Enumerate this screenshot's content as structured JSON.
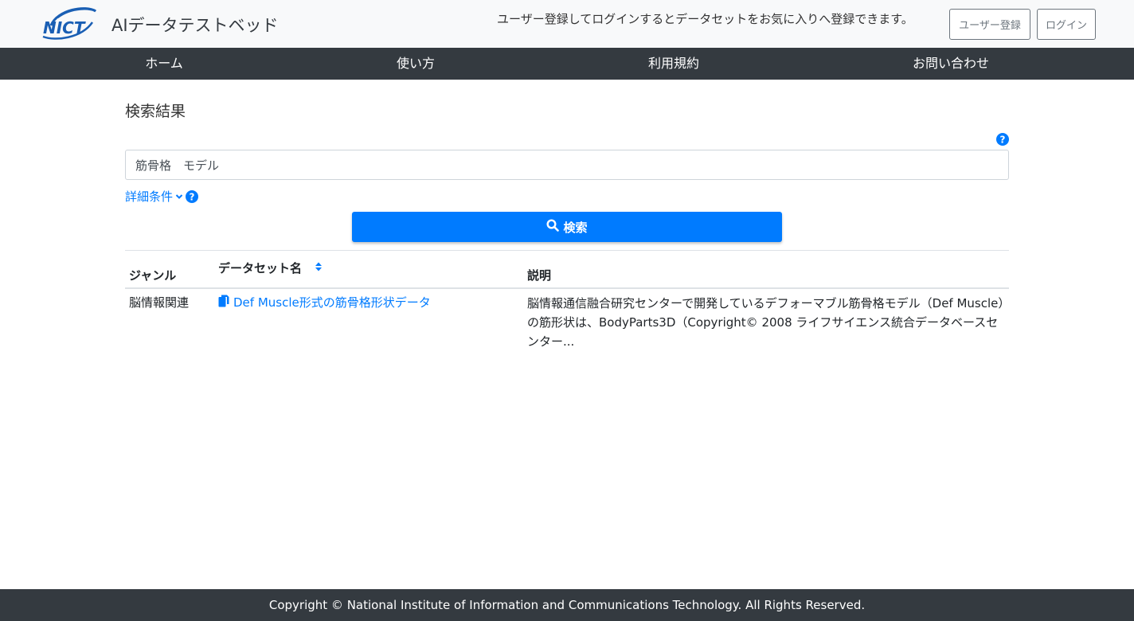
{
  "header": {
    "logo_text": "NICT",
    "app_title": "AIデータテストベッド",
    "login_message": "ユーザー登録してログインするとデータセットをお気に入りへ登録できます。",
    "register_button": "ユーザー登録",
    "login_button": "ログイン"
  },
  "nav": {
    "items": [
      {
        "label": "ホーム"
      },
      {
        "label": "使い方"
      },
      {
        "label": "利用規約"
      },
      {
        "label": "お問い合わせ"
      }
    ]
  },
  "search": {
    "section_title": "検索結果",
    "query_value": "筋骨格　モデル",
    "detail_label": "詳細条件",
    "button_label": "検索",
    "button_icon": "search-icon",
    "help_icon": "question-circle-icon"
  },
  "results": {
    "columns": {
      "genre": "ジャンル",
      "dataset_name": "データセット名",
      "description": "説明"
    },
    "sort_icon": "sort-icon",
    "rows": [
      {
        "genre": "脳情報関連",
        "dataset_name": "Def Muscle形式の筋骨格形状データ",
        "dataset_icon": "file-copy-icon",
        "description": "脳情報通信融合研究センターで開発しているデフォーマブル筋骨格モデル（Def Muscle）の筋形状は、BodyParts3D（Copyright© 2008 ライフサイエンス統合データベースセンター..."
      }
    ]
  },
  "footer": {
    "copyright": "Copyright © National Institute of Information and Communications Technology. All Rights Reserved."
  },
  "colors": {
    "primary": "#007bff",
    "navbar_bg": "#343a40",
    "header_bg": "#f8f9fa",
    "logo_blue": "#1a5fb4"
  }
}
